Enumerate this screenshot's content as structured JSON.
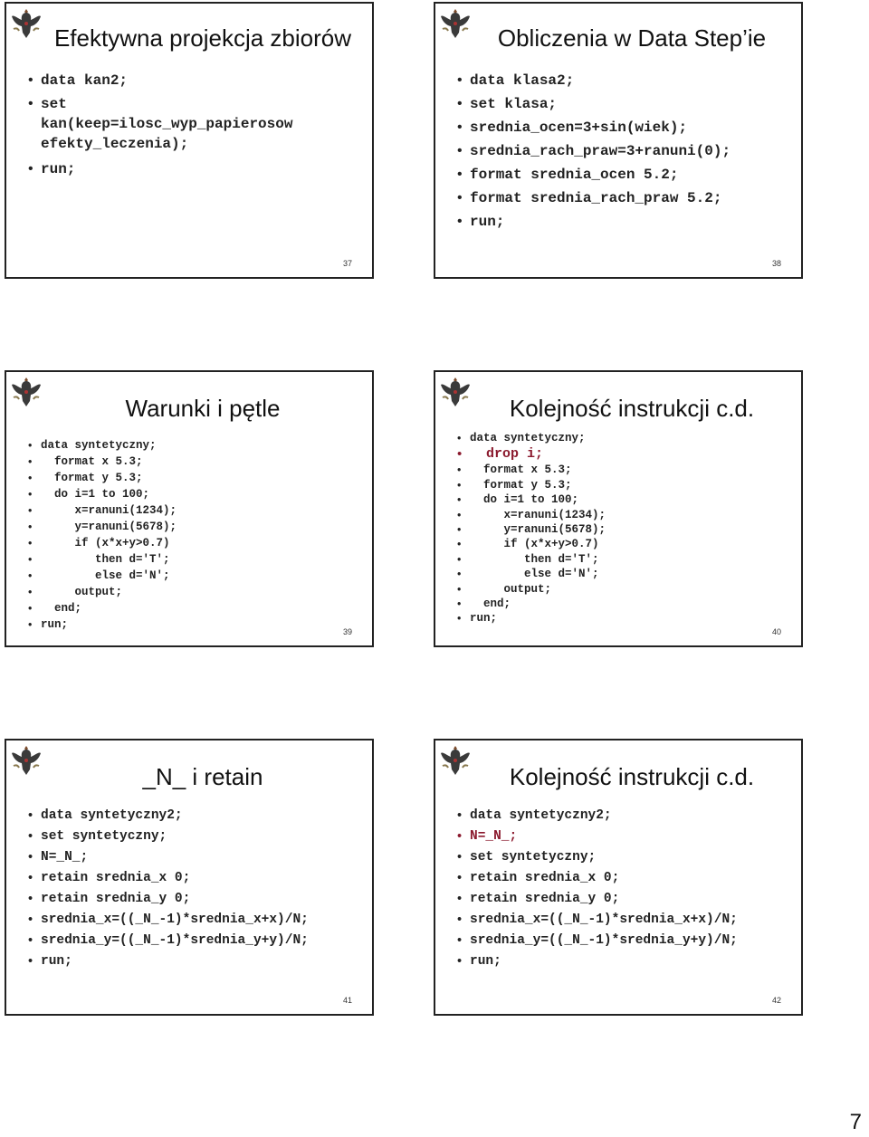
{
  "slides": [
    {
      "title": "Efektywna projekcja zbiorów",
      "number": "37",
      "lines": [
        {
          "text": "data kan2;"
        },
        {
          "text": "set\nkan(keep=ilosc_wyp_papierosow\nefekty_leczenia);"
        },
        {
          "text": "run;"
        }
      ]
    },
    {
      "title": "Obliczenia w Data Step’ie",
      "number": "38",
      "lines": [
        {
          "text": "data klasa2;"
        },
        {
          "text": "set klasa;"
        },
        {
          "text": "srednia_ocen=3+sin(wiek);"
        },
        {
          "text": "srednia_rach_praw=3+ranuni(0);"
        },
        {
          "text": "format srednia_ocen 5.2;"
        },
        {
          "text": "format srednia_rach_praw 5.2;"
        },
        {
          "text": "run;"
        }
      ]
    },
    {
      "title": "Warunki i pętle",
      "number": "39",
      "lines": [
        {
          "text": "data syntetyczny;"
        },
        {
          "text": "  format x 5.3;"
        },
        {
          "text": "  format y 5.3;"
        },
        {
          "text": "  do i=1 to 100;"
        },
        {
          "text": "     x=ranuni(1234);"
        },
        {
          "text": "     y=ranuni(5678);"
        },
        {
          "text": "     if (x*x+y>0.7)"
        },
        {
          "text": "        then d='T';"
        },
        {
          "text": "        else d='N';"
        },
        {
          "text": "     output;"
        },
        {
          "text": "  end;"
        },
        {
          "text": "run;"
        }
      ]
    },
    {
      "title": "Kolejność instrukcji c.d.",
      "number": "40",
      "lines": [
        {
          "text": "data syntetyczny;"
        },
        {
          "text": "  drop i;",
          "highlight": true
        },
        {
          "text": "  format x 5.3;"
        },
        {
          "text": "  format y 5.3;"
        },
        {
          "text": "  do i=1 to 100;"
        },
        {
          "text": "     x=ranuni(1234);"
        },
        {
          "text": "     y=ranuni(5678);"
        },
        {
          "text": "     if (x*x+y>0.7)"
        },
        {
          "text": "        then d='T';"
        },
        {
          "text": "        else d='N';"
        },
        {
          "text": "     output;"
        },
        {
          "text": "  end;"
        },
        {
          "text": "run;"
        }
      ]
    },
    {
      "title": "_N_ i retain",
      "number": "41",
      "lines": [
        {
          "text": "data syntetyczny2;"
        },
        {
          "text": "set syntetyczny;"
        },
        {
          "text": "N=_N_;"
        },
        {
          "text": "retain srednia_x 0;"
        },
        {
          "text": "retain srednia_y 0;"
        },
        {
          "text": "srednia_x=((_N_-1)*srednia_x+x)/N;"
        },
        {
          "text": "srednia_y=((_N_-1)*srednia_y+y)/N;"
        },
        {
          "text": "run;"
        }
      ]
    },
    {
      "title": "Kolejność instrukcji c.d.",
      "number": "42",
      "lines": [
        {
          "text": "data syntetyczny2;"
        },
        {
          "text": "N=_N_;",
          "highlight": true
        },
        {
          "text": "set syntetyczny;"
        },
        {
          "text": "retain srednia_x 0;"
        },
        {
          "text": "retain srednia_y 0;"
        },
        {
          "text": "srednia_x=((_N_-1)*srednia_x+x)/N;"
        },
        {
          "text": "srednia_y=((_N_-1)*srednia_y+y)/N;"
        },
        {
          "text": "run;"
        }
      ]
    }
  ],
  "colors": {
    "highlight": "#8b1a2e",
    "text": "#222222",
    "border": "#222222"
  },
  "logo_icon": "eagle-emblem-icon",
  "page_number": "7"
}
